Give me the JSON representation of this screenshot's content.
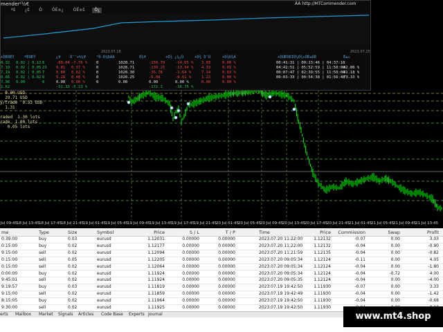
{
  "panel": {
    "title": "mender²½€",
    "url": "ÂÀ http://MTCommender.com",
    "tabs": [
      "ºš",
      "¿š",
      "Ò",
      "ÒÉ±¿",
      "ÒÊ±š",
      "Ò¿"
    ],
    "active_tab": 5,
    "date_left": "2023.07.18",
    "date_right": "2023.07.25",
    "headers": [
      "+ÒÈÒÉÝ",
      "ºÈÒÉÝ",
      "¿¥",
      "Ò¯¯+%¼¥",
      "°Ò-Ò¼ÐÀÀ",
      "Ò¾¥",
      "+Ò¾ ¿¼¿Ù",
      "+Ò¾ Ò¯Ù",
      "+Ò¾Ù¾À",
      "+ÒÙÈÒÉÍÒ¼Ò¾¤ÓÊ±ÓÈ",
      "Ê±¤"
    ],
    "rows": [
      [
        "0.32",
        "0.02 | 0.12",
        "6",
        "-80.04",
        "-7.76 %",
        "0",
        "1028.71",
        "-150.70",
        "-14.65 %",
        "3.03",
        "0.00 %",
        "00:41:31 | 00:13:46 | 04:37:18",
        ""
      ],
      [
        "7.19",
        "0.02 | 0.05",
        "23",
        "9.81",
        "0.37 %",
        "0",
        "1028.71",
        "-139.25",
        "-13.54 %",
        "4.33",
        "0.01 %",
        "04:42:51 | 05:52:59 | 11:50:00",
        "42.86 %"
      ],
      [
        "7.19",
        "0.02 | 0.05",
        "7",
        "0.80",
        "0.62 %",
        "0",
        "1020.30",
        "-36.78",
        "-1.64 %",
        "7.14",
        "0.03 %",
        "00:07:47 | 02:39:55 | 11:50:00",
        "41.18 %"
      ],
      [
        "0.66",
        "0.02 | 0.02",
        "8",
        "5.28",
        "0.48 %",
        "0",
        "1020.25",
        "-6.08",
        "-0.61 %",
        "1.22",
        "0.00 %",
        "00:03:33 | 00:54:38 | 01:56:48",
        "73.33 %"
      ],
      [
        "7.96",
        "0.00",
        "0",
        "0.00",
        "0.00 %",
        "0",
        "0.00",
        "0.00",
        "0.00 %",
        "0.00",
        "0.00 %",
        "",
        ""
      ],
      [
        "1.62",
        "",
        "",
        "-51.33",
        "-5.13 %",
        "",
        "",
        "-172.3",
        "-16.75 %",
        "",
        "",
        "",
        ""
      ]
    ]
  },
  "info_box": {
    "lines": [
      "  0.00 USD",
      "  29.71 USD",
      "y/trade  0.53 USD",
      "  1.31",
      "",
      "raded  1.30 lots",
      "rade  1.00 lots",
      "   0.05 lots"
    ]
  },
  "time_axis": [
    "19 Jul 09:45",
    "18 Jul 13:45",
    "18 Jul 17:45",
    "18 Jul 21:45",
    "19 Jul 01:45",
    "19 Jul 05:45",
    "19 Jul 09:45",
    "19 Jul 13:45",
    "19 Jul 17:45",
    "19 Jul 21:45",
    "20 Jul 01:45",
    "20 Jul 05:45",
    "20 Jul 09:45",
    "20 Jul 13:45",
    "20 Jul 17:45",
    "20 Jul 21:45",
    "21 Jul 01:45",
    "21 Jul 05:45",
    "21 Jul 09:45",
    "21 Jul 13:45"
  ],
  "table": {
    "headers": [
      "me",
      "Type",
      "Size",
      "Symbol",
      "Price",
      "S / L",
      "T / P",
      "Time",
      "Price",
      "Commission",
      "Swap",
      "Profit"
    ],
    "rows": [
      [
        "0:39:00",
        "buy",
        "0.03",
        "eurusd",
        "1.12031",
        "0.00000",
        "0.00000",
        "2023.07.20 11:22:00",
        "1.12132",
        "-0.07",
        "0.00",
        "3.03"
      ],
      [
        "0:15:00",
        "buy",
        "0.02",
        "eurusd",
        "1.12177",
        "0.00000",
        "0.00000",
        "2023.07.20 11:22:00",
        "1.12132",
        "-0.04",
        "0.00",
        "-0.90"
      ],
      [
        "9:15:00",
        "sell",
        "0.02",
        "eurusd",
        "1.12094",
        "0.00000",
        "0.00000",
        "2023.07.20 11:21:59",
        "1.12135",
        "-0.04",
        "0.00",
        "-0.82"
      ],
      [
        "0:15:00",
        "sell",
        "0.05",
        "eurusd",
        "1.12205",
        "0.00000",
        "0.00000",
        "2023.07.20 09:05:34",
        "1.12124",
        "-0.11",
        "0.00",
        "4.05"
      ],
      [
        "0:15:00",
        "sell",
        "0.02",
        "eurusd",
        "1.12064",
        "0.00000",
        "0.00000",
        "2023.07.20 09:05:34",
        "1.12124",
        "-0.04",
        "0.00",
        "-1.80"
      ],
      [
        "0:00:00",
        "buy",
        "0.02",
        "eurusd",
        "1.11924",
        "0.00000",
        "0.00000",
        "2023.07.20 09:05:34",
        "1.12124",
        "-0.04",
        "-0.72",
        "4.00"
      ],
      [
        "9:45:01",
        "sell",
        "0.02",
        "eurusd",
        "1.11924",
        "0.00000",
        "0.00000",
        "2023.07.20 09:05:35",
        "1.12124",
        "-0.04",
        "0.00",
        "-4.00"
      ],
      [
        "9:19:57",
        "buy",
        "0.03",
        "eurusd",
        "1.11819",
        "0.00000",
        "0.00000",
        "2023.07.19 19:42:50",
        "1.11930",
        "-0.07",
        "0.00",
        "3.33"
      ],
      [
        "9:15:00",
        "sell",
        "0.02",
        "eurusd",
        "1.11859",
        "0.00000",
        "0.00000",
        "2023.07.19 19:42:49",
        "1.11930",
        "-0.04",
        "0.00",
        "-1.42"
      ],
      [
        "8:15:05",
        "buy",
        "0.02",
        "eurusd",
        "1.11964",
        "0.00000",
        "0.00000",
        "2023.07.19 19:42:50",
        "1.11930",
        "-0.04",
        "0.00",
        "-0.68"
      ],
      [
        "9:30:00",
        "sell",
        "0.02",
        "eurusd",
        "1.11925",
        "0.00000",
        "0.00000",
        "2023.07.19 19:42:50",
        "1.11930",
        "-0.04",
        "0.00",
        "-0.10"
      ]
    ]
  },
  "bottom_tabs": [
    "erts",
    "Mailbox",
    "Market",
    "Signals",
    "Articles",
    "Code Base",
    "Experts",
    "Journal"
  ],
  "watermark": "www.mt4.shop",
  "colors": {
    "candle": "#00ff00",
    "equity_line": "#1e9bd7",
    "level_line": "#3c8a3c",
    "dashed_level": "#6aa84f"
  }
}
